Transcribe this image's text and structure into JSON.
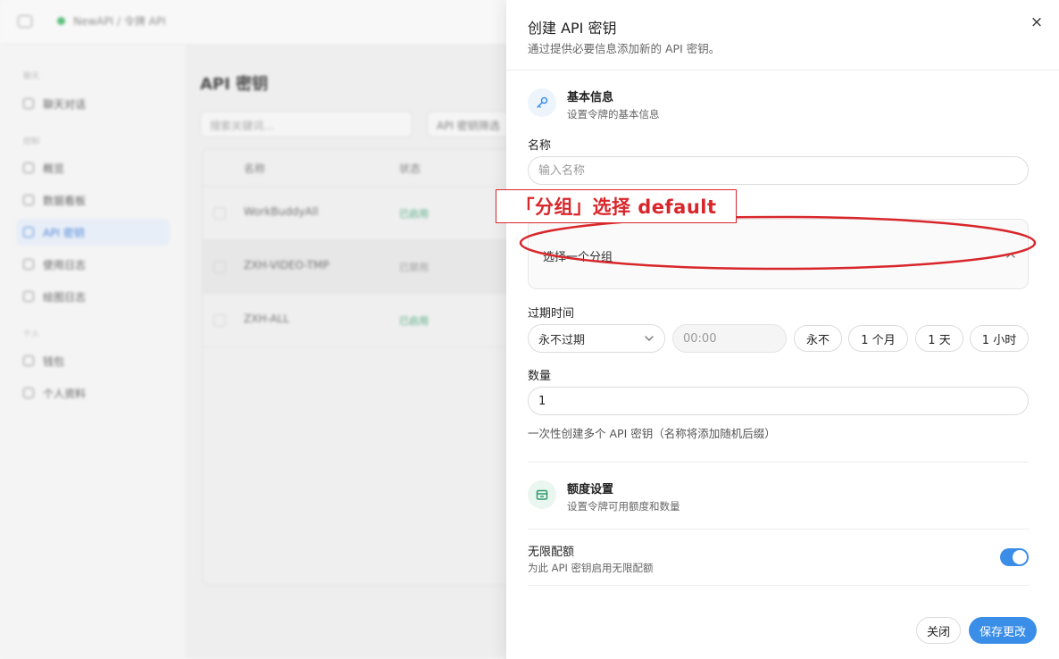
{
  "background": {
    "breadcrumb": "NewAPI / 令牌 API",
    "sidebar": {
      "sections": [
        "聊天",
        "控制",
        "个人"
      ],
      "items": [
        {
          "label": "聊天对话",
          "active": false
        },
        {
          "label": "概览",
          "active": false
        },
        {
          "label": "数据看板",
          "active": false
        },
        {
          "label": "API 密钥",
          "active": true
        },
        {
          "label": "使用日志",
          "active": false
        },
        {
          "label": "绘图日志",
          "active": false
        },
        {
          "label": "钱包",
          "active": false
        },
        {
          "label": "个人资料",
          "active": false
        }
      ]
    },
    "page_title": "API 密钥",
    "search_placeholder": "搜索关键词...",
    "filter_label": "API 密钥筛选",
    "table": {
      "columns": [
        "名称",
        "状态"
      ],
      "rows": [
        {
          "name": "WorkBuddyAll",
          "status": "已启用"
        },
        {
          "name": "ZXH-VIDEO-TMP",
          "status": "已禁用"
        },
        {
          "name": "ZXH-ALL",
          "status": "已启用"
        }
      ]
    }
  },
  "drawer": {
    "title": "创建 API 密钥",
    "description": "通过提供必要信息添加新的 API 密钥。",
    "close_icon": "×",
    "basic_section": {
      "icon": "key-icon",
      "title": "基本信息",
      "subtitle": "设置令牌的基本信息"
    },
    "name_field": {
      "label": "名称",
      "placeholder": "输入名称",
      "value": ""
    },
    "group_field": {
      "placeholder": "选择一个分组"
    },
    "expiry": {
      "label": "过期时间",
      "selected": "永不过期",
      "time_placeholder": "00:00",
      "quick_options": [
        "永不",
        "1 个月",
        "1 天",
        "1 小时"
      ]
    },
    "quantity": {
      "label": "数量",
      "value": "1",
      "hint": "一次性创建多个 API 密钥（名称将添加随机后缀）"
    },
    "quota_section": {
      "icon": "wallet-icon",
      "title": "额度设置",
      "subtitle": "设置令牌可用额度和数量"
    },
    "unlimited_quota": {
      "label": "无限配额",
      "description": "为此 API 密钥启用无限配额",
      "enabled": true
    },
    "buttons": {
      "close": "关闭",
      "save": "保存更改"
    }
  },
  "annotation": {
    "text": "「分组」选择 default",
    "color": "#d8262b"
  },
  "colors": {
    "accent": "#3b8ee8",
    "annotation": "#d8262b",
    "quota_icon": "#2f9a6a"
  }
}
